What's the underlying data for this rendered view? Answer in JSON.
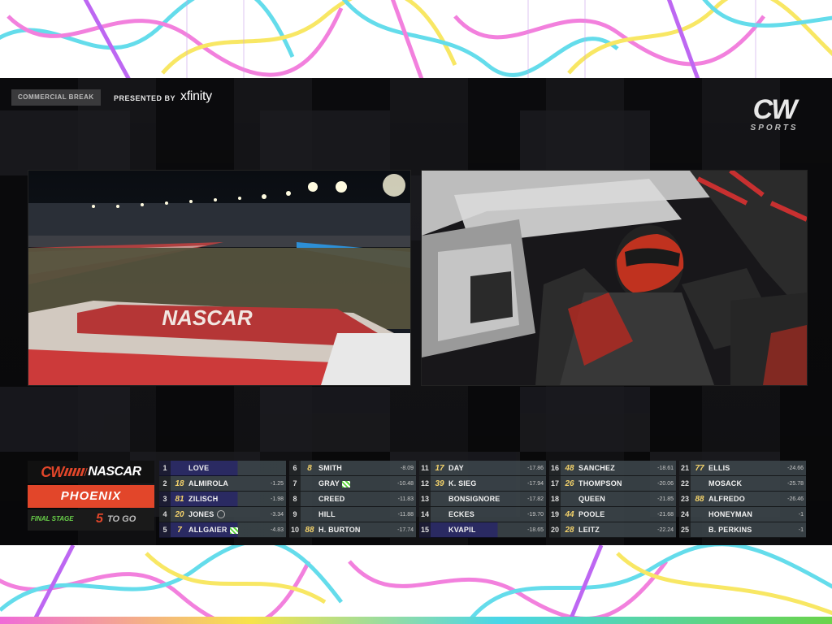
{
  "header": {
    "break_label": "COMMERCIAL BREAK",
    "presented_by": "PRESENTED BY",
    "sponsor": "xfinity",
    "network": "CW",
    "network_sub": "SPORTS"
  },
  "feeds": {
    "left": "track-camera-feed",
    "right": "in-car-camera-feed"
  },
  "ticker": {
    "brand_cw": "CW",
    "brand_nascar": "NASCAR",
    "track": "PHOENIX",
    "stage": "FINAL STAGE",
    "laps_value": "5",
    "laps_text": "TO GO",
    "colors": {
      "accent": "#e2462a",
      "green": "#6ad34a",
      "highlight": "#2a2a62"
    },
    "columns": [
      [
        {
          "pos": "1",
          "num": "",
          "name": "LOVE",
          "gap": "",
          "hl": true
        },
        {
          "pos": "2",
          "num": "18",
          "name": "ALMIROLA",
          "gap": "-1.25"
        },
        {
          "pos": "3",
          "num": "81",
          "name": "ZILISCH",
          "gap": "-1.98",
          "hl": true
        },
        {
          "pos": "4",
          "num": "20",
          "name": "JONES",
          "gap": "-3.34",
          "icon": "pit"
        },
        {
          "pos": "5",
          "num": "7",
          "name": "ALLGAIER",
          "gap": "-4.83",
          "hl": true,
          "icon": "flag"
        }
      ],
      [
        {
          "pos": "6",
          "num": "8",
          "name": "SMITH",
          "gap": "-8.09"
        },
        {
          "pos": "7",
          "num": "",
          "name": "GRAY",
          "gap": "-10.48",
          "icon": "flag"
        },
        {
          "pos": "8",
          "num": "",
          "name": "CREED",
          "gap": "-11.83"
        },
        {
          "pos": "9",
          "num": "",
          "name": "HILL",
          "gap": "-11.88"
        },
        {
          "pos": "10",
          "num": "88",
          "name": "H. BURTON",
          "gap": "-17.74"
        }
      ],
      [
        {
          "pos": "11",
          "num": "17",
          "name": "DAY",
          "gap": "-17.86"
        },
        {
          "pos": "12",
          "num": "39",
          "name": "K. SIEG",
          "gap": "-17.94"
        },
        {
          "pos": "13",
          "num": "",
          "name": "BONSIGNORE",
          "gap": "-17.82"
        },
        {
          "pos": "14",
          "num": "",
          "name": "ECKES",
          "gap": "-19.70"
        },
        {
          "pos": "15",
          "num": "",
          "name": "KVAPIL",
          "gap": "-18.65",
          "hl": true
        }
      ],
      [
        {
          "pos": "16",
          "num": "48",
          "name": "SANCHEZ",
          "gap": "-18.61"
        },
        {
          "pos": "17",
          "num": "26",
          "name": "THOMPSON",
          "gap": "-20.06"
        },
        {
          "pos": "18",
          "num": "",
          "name": "QUEEN",
          "gap": "-21.85"
        },
        {
          "pos": "19",
          "num": "44",
          "name": "POOLE",
          "gap": "-21.68"
        },
        {
          "pos": "20",
          "num": "28",
          "name": "LEITZ",
          "gap": "-22.24"
        }
      ],
      [
        {
          "pos": "21",
          "num": "77",
          "name": "ELLIS",
          "gap": "-24.66"
        },
        {
          "pos": "22",
          "num": "",
          "name": "MOSACK",
          "gap": "-25.78"
        },
        {
          "pos": "23",
          "num": "88",
          "name": "ALFREDO",
          "gap": "-26.46"
        },
        {
          "pos": "24",
          "num": "",
          "name": "HONEYMAN",
          "gap": "-1"
        },
        {
          "pos": "25",
          "num": "",
          "name": "B. PERKINS",
          "gap": "-1"
        }
      ]
    ]
  }
}
